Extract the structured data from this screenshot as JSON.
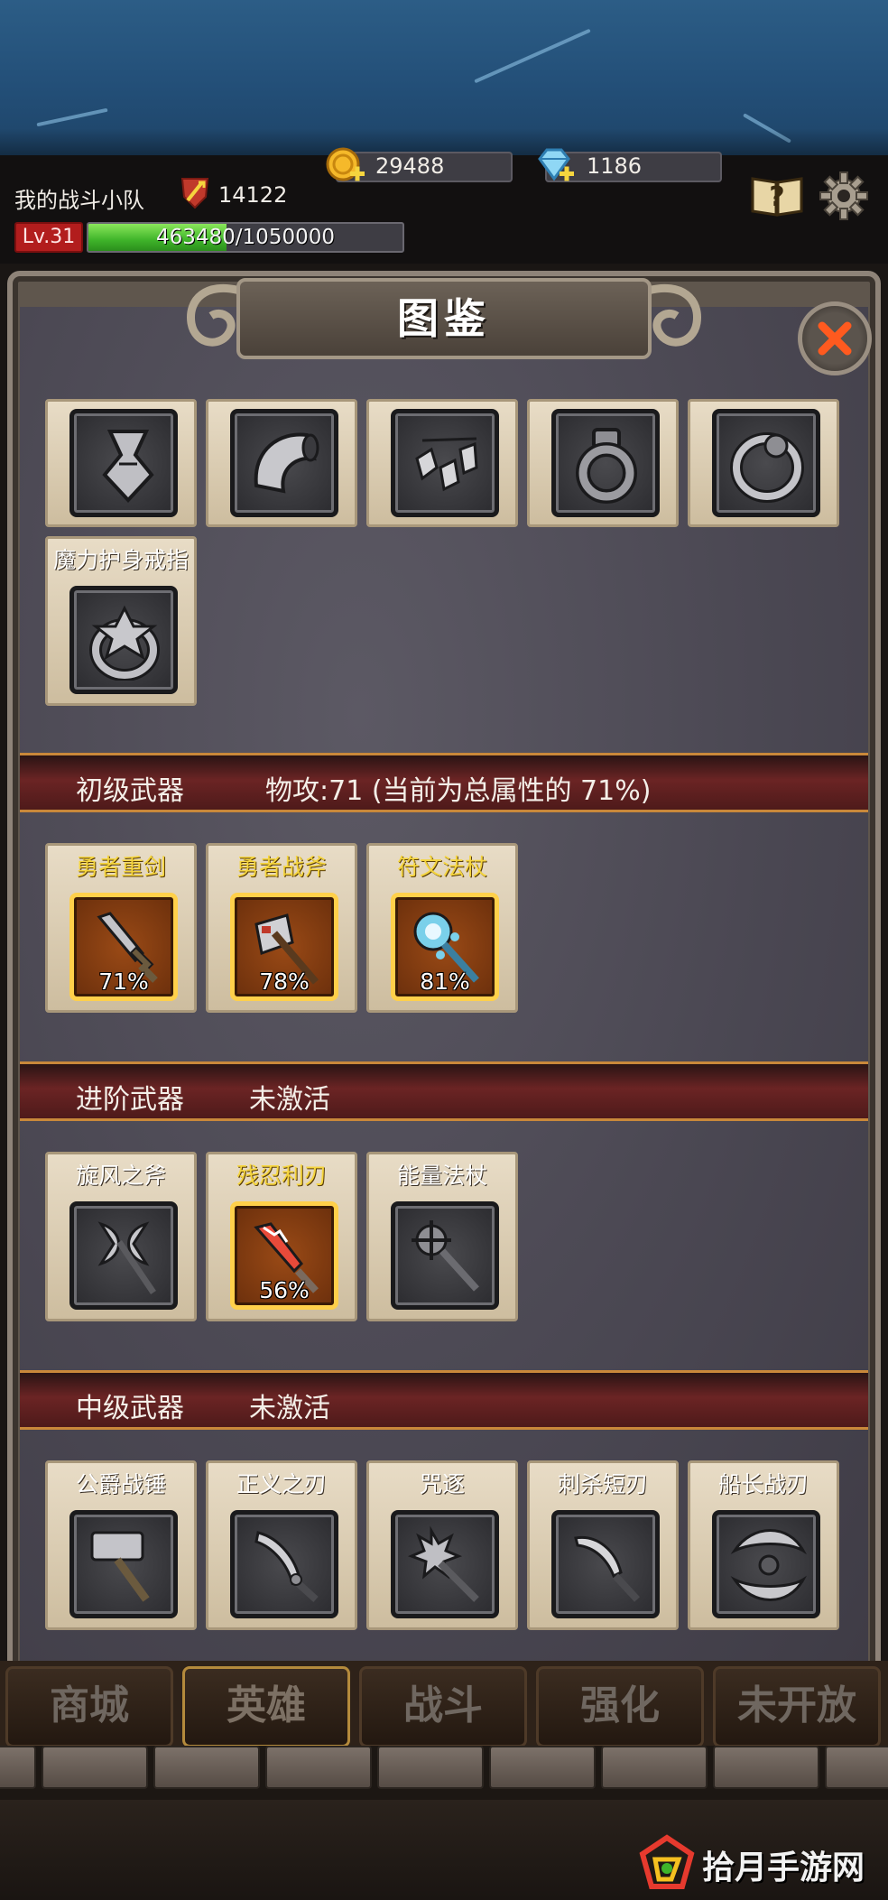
{
  "hud": {
    "team_name": "我的战斗小队",
    "power": "14122",
    "gold": "29488",
    "diamonds": "1186",
    "level": "Lv.31",
    "exp_text": "463480/1050000",
    "exp_progress": 0.441
  },
  "panel": {
    "title": "图鉴"
  },
  "accessories": {
    "row1": [
      {
        "name": "",
        "icon": "amulet-icon"
      },
      {
        "name": "",
        "icon": "horn-icon"
      },
      {
        "name": "",
        "icon": "bone-charms-icon"
      },
      {
        "name": "",
        "icon": "iron-ring-icon"
      },
      {
        "name": "",
        "icon": "silver-ring-icon"
      }
    ],
    "row2": [
      {
        "name": "魔力护身戒指",
        "icon": "magic-ring-icon"
      }
    ]
  },
  "sections": [
    {
      "label": "初级武器",
      "status": "物攻:71 (当前为总属性的 71%)",
      "items": [
        {
          "name": "勇者重剑",
          "pct": "71%",
          "icon": "sword-icon",
          "active": true
        },
        {
          "name": "勇者战斧",
          "pct": "78%",
          "icon": "axe-icon",
          "active": true
        },
        {
          "name": "符文法杖",
          "pct": "81%",
          "icon": "staff-icon",
          "active": true
        }
      ]
    },
    {
      "label": "进阶武器",
      "status": "未激活",
      "items": [
        {
          "name": "旋风之斧",
          "pct": "",
          "icon": "double-axe-icon",
          "active": false
        },
        {
          "name": "残忍利刃",
          "pct": "56%",
          "icon": "red-blade-icon",
          "active": true
        },
        {
          "name": "能量法杖",
          "pct": "",
          "icon": "mace-staff-icon",
          "active": false
        }
      ]
    },
    {
      "label": "中级武器",
      "status": "未激活",
      "items": [
        {
          "name": "公爵战锤",
          "pct": "",
          "icon": "hammer-icon",
          "active": false
        },
        {
          "name": "正义之刃",
          "pct": "",
          "icon": "curved-sword-icon",
          "active": false
        },
        {
          "name": "咒逐",
          "pct": "",
          "icon": "cross-mace-icon",
          "active": false
        },
        {
          "name": "刺杀短刃",
          "pct": "",
          "icon": "dagger-icon",
          "active": false
        },
        {
          "name": "船长战刃",
          "pct": "",
          "icon": "crescent-blade-icon",
          "active": false
        }
      ]
    }
  ],
  "nav": {
    "tabs": [
      "商城",
      "英雄",
      "战斗",
      "强化",
      "未开放"
    ],
    "active": "英雄"
  },
  "watermark": {
    "brand": "拾月手游网"
  },
  "colors": {
    "gold_text": "#f5d53e",
    "exp_green": "#3fb42a",
    "level_red": "#b21d1d",
    "banner_red": "#6b2424",
    "slot_orange": "#9a4a16"
  }
}
